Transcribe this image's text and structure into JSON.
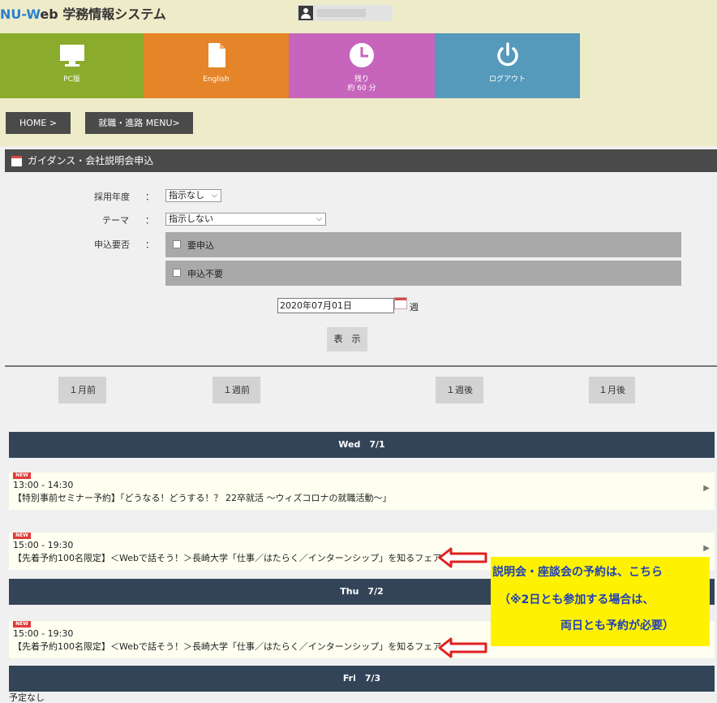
{
  "header": {
    "logo_nu": "NU-",
    "logo_w": "W",
    "logo_rest": "eb 学務情報システム"
  },
  "tiles": [
    {
      "label": "PC版",
      "sub": "",
      "icon": "monitor-icon",
      "color": "#8aab2b"
    },
    {
      "label": "English",
      "sub": "",
      "icon": "document-icon",
      "color": "#e58428"
    },
    {
      "label": "残り",
      "sub": "約 60 分",
      "icon": "clock-icon",
      "color": "#c765bc"
    },
    {
      "label": "ログアウト",
      "sub": "",
      "icon": "power-icon",
      "color": "#5599bb"
    }
  ],
  "breadcrumb": {
    "home": "HOME >",
    "menu": "就職・進路 MENU>"
  },
  "section": {
    "title": "ガイダンス・会社説明会申込"
  },
  "form": {
    "year_label": "採用年度",
    "year_value": "指示なし",
    "theme_label": "テーマ",
    "theme_value": "指示しない",
    "apply_label": "申込要否",
    "colon": "：",
    "opt_required": "要申込",
    "opt_not_required": "申込不要",
    "date_value": "2020年07月01日",
    "week_label": "週",
    "show_button": "表　示",
    "select_arrow": "⌵"
  },
  "pager": {
    "month_prev": "１月前",
    "week_prev": "１週前",
    "week_next": "１週後",
    "month_next": "１月後"
  },
  "days": [
    {
      "head": "Wed　7/1",
      "events": [
        {
          "badge": "NEW",
          "time": "13:00 - 14:30",
          "title": "【特別事前セミナー予約】「どうなる！どうする！？ 22卒就活 ～ウィズコロナの就職活動～」"
        },
        {
          "badge": "NEW",
          "time": "15:00 - 19:30",
          "title": "【先着予約100名限定】＜Webで話そう！＞長崎大学「仕事／はたらく／インターンシップ」を知るフェア"
        }
      ]
    },
    {
      "head": "Thu　7/2",
      "events": [
        {
          "badge": "NEW",
          "time": "15:00 - 19:30",
          "title": "【先着予約100名限定】＜Webで話そう！＞長崎大学「仕事／はたらく／インターンシップ」を知るフェア"
        }
      ]
    },
    {
      "head": "Fri　7/3",
      "empty": "予定なし"
    }
  ],
  "event_arrow": "▶",
  "annotation": {
    "line1": "説明会・座談会の予約は、こちら",
    "line2": "（※2日とも参加する場合は、",
    "line3": "両日とも予約が必要）",
    "color": "#1f3fb8",
    "background": "#fff200",
    "arrow_color": "#e02020"
  }
}
